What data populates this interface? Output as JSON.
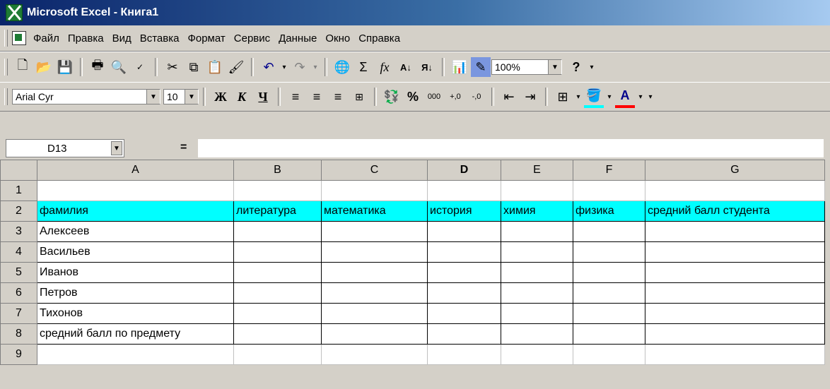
{
  "window": {
    "title": "Microsoft Excel - Книга1"
  },
  "menu": [
    "Файл",
    "Правка",
    "Вид",
    "Вставка",
    "Формат",
    "Сервис",
    "Данные",
    "Окно",
    "Справка"
  ],
  "toolbar": {
    "zoom": "100%"
  },
  "format": {
    "font": "Arial Cyr",
    "size": "10"
  },
  "formula": {
    "cell": "D13",
    "eq": "="
  },
  "columns": [
    "A",
    "B",
    "C",
    "D",
    "E",
    "F",
    "G"
  ],
  "rows": [
    [
      "",
      "",
      "",
      "",
      "",
      "",
      ""
    ],
    [
      "фамилия",
      "литература",
      "математика",
      "история",
      "химия",
      "физика",
      "средний балл студента"
    ],
    [
      "Алексеев",
      "",
      "",
      "",
      "",
      "",
      ""
    ],
    [
      "Васильев",
      "",
      "",
      "",
      "",
      "",
      ""
    ],
    [
      "Иванов",
      "",
      "",
      "",
      "",
      "",
      ""
    ],
    [
      "Петров",
      "",
      "",
      "",
      "",
      "",
      ""
    ],
    [
      "Тихонов",
      "",
      "",
      "",
      "",
      "",
      ""
    ],
    [
      "средний балл по предмету",
      "",
      "",
      "",
      "",
      "",
      ""
    ],
    [
      "",
      "",
      "",
      "",
      "",
      "",
      ""
    ]
  ],
  "row_numbers": [
    "1",
    "2",
    "3",
    "4",
    "5",
    "6",
    "7",
    "8",
    "9"
  ],
  "colors": {
    "header_fill": "#00ffff",
    "title_bar": "#0a246a"
  }
}
